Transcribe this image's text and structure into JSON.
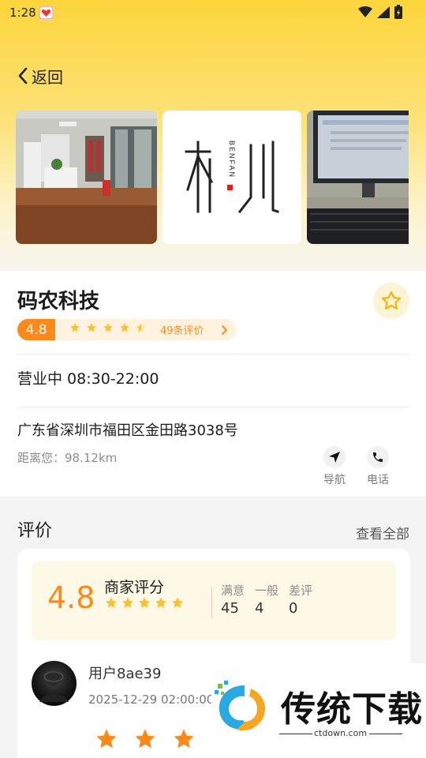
{
  "status_bar": {
    "time": "1:28"
  },
  "nav": {
    "back_label": "返回"
  },
  "gallery": {
    "logo_text": "BENFAN"
  },
  "shop": {
    "name": "码农科技",
    "rating": "4.8",
    "review_count": "49条评价",
    "hours": "营业中 08:30-22:00",
    "address": "广东省深圳市福田区金田路3038号",
    "distance": "距离您：98.12km",
    "actions": [
      {
        "label": "导航",
        "icon": "navigation-icon"
      },
      {
        "label": "电话",
        "icon": "phone-icon"
      }
    ]
  },
  "reviews": {
    "title": "评价",
    "view_all": "查看全部",
    "summary": {
      "score": "4.8",
      "label": "商家评分",
      "stats": [
        {
          "label": "满意",
          "value": "45"
        },
        {
          "label": "一般",
          "value": "4"
        },
        {
          "label": "差评",
          "value": "0"
        }
      ]
    },
    "items": [
      {
        "user": "用户8ae39",
        "date": "2025-12-29 02:00:00"
      }
    ]
  },
  "watermark": {
    "text": "传统下载",
    "url": "ctdown.com"
  },
  "colors": {
    "accent": "#fb8a1b",
    "star": "#fbc02d",
    "hero_top": "#fcd53b"
  }
}
